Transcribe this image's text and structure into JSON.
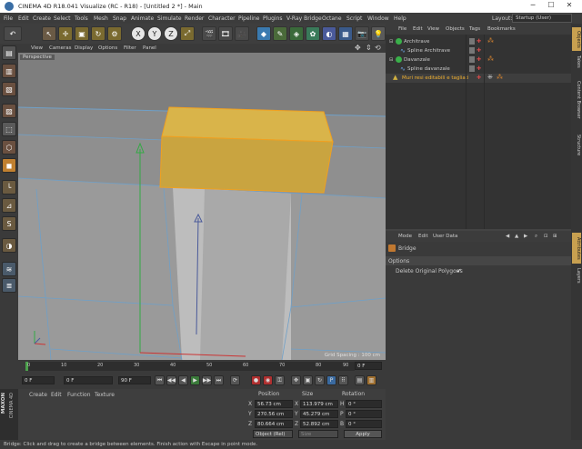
{
  "window": {
    "title": "CINEMA 4D R18.041 Visualize (RC - R18) - [Untitled 2 *] - Main",
    "min": "─",
    "max": "☐",
    "close": "✕"
  },
  "menu": [
    "File",
    "Edit",
    "Create",
    "Select",
    "Tools",
    "Mesh",
    "Snap",
    "Animate",
    "Simulate",
    "Render",
    "Character",
    "Pipeline",
    "Plugins",
    "V-Ray Bridge",
    "Octane",
    "Script",
    "Window",
    "Help"
  ],
  "layout": {
    "label": "Layout:",
    "value": "Startup (User)"
  },
  "toolbar": {
    "undo": "↶",
    "x": "X",
    "y": "Y",
    "z": "Z"
  },
  "viewport": {
    "menu": [
      "View",
      "Cameras",
      "Display",
      "Options",
      "Filter",
      "Panel"
    ],
    "label": "Perspective",
    "grid_spacing": "Grid Spacing : 100 cm"
  },
  "timeline": {
    "ticks": [
      "0",
      "10",
      "20",
      "30",
      "40",
      "50",
      "60",
      "70",
      "80",
      "90"
    ],
    "frame_field": "0 F"
  },
  "transport": {
    "start": "0 F",
    "current": "0 F",
    "end": "90 F",
    "end2": "90 F"
  },
  "materials": {
    "menu": [
      "Create",
      "Edit",
      "Function",
      "Texture"
    ],
    "brand1": "MAXON",
    "brand2": "CINEMA 4D"
  },
  "coords": {
    "headers": [
      "Position",
      "Size",
      "Rotation"
    ],
    "rows": [
      {
        "axis": "X",
        "pos": "56.73 cm",
        "size_axis": "X",
        "size": "113.979 cm",
        "rot_axis": "H",
        "rot": "0 °"
      },
      {
        "axis": "Y",
        "pos": "270.56 cm",
        "size_axis": "Y",
        "size": "45.279 cm",
        "rot_axis": "P",
        "rot": "0 °"
      },
      {
        "axis": "Z",
        "pos": "80.664 cm",
        "size_axis": "Z",
        "size": "52.892 cm",
        "rot_axis": "B",
        "rot": "0 °"
      }
    ],
    "mode": "Object (Rel)",
    "size_mode": "Size",
    "apply": "Apply"
  },
  "objects": {
    "menu": [
      "File",
      "Edit",
      "View",
      "Objects",
      "Tags",
      "Bookmarks"
    ],
    "rows": [
      {
        "name": "Architrave",
        "indent": 0,
        "selected": false
      },
      {
        "name": "Spline Architrave",
        "indent": 1,
        "selected": false
      },
      {
        "name": "Davanzale",
        "indent": 0,
        "selected": false
      },
      {
        "name": "Spline davanzale",
        "indent": 1,
        "selected": false
      },
      {
        "name": "Muri resi editabili e tagliati",
        "indent": 0,
        "selected": true
      }
    ]
  },
  "attributes": {
    "menu": [
      "Mode",
      "Edit",
      "User Data"
    ],
    "tool_name": "Bridge",
    "section": "Options",
    "option_label": "Delete Original Polygons",
    "option_checked": "✔"
  },
  "right_tabs": [
    "Objects",
    "Takes",
    "Content Browser",
    "Structure",
    "Attributes",
    "Layers"
  ],
  "status": "Bridge: Click and drag to create a bridge between elements. Finish action with Escape in point mode."
}
